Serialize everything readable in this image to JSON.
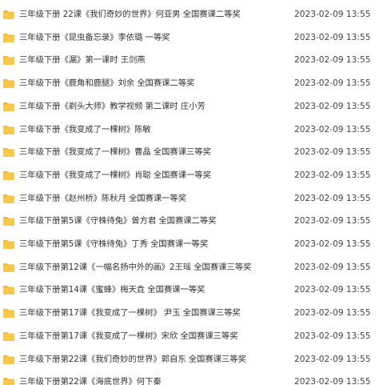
{
  "colors": {
    "folder": "#f7c84b",
    "folder_tab": "#f0b93a",
    "text": "#333333",
    "date_text": "#444444"
  },
  "icon": "folder-icon",
  "files": [
    {
      "name": "三年级下册 22课《我们奇妙的世界》何亚男 全国赛课二等奖",
      "date": "2023-02-09 13:55"
    },
    {
      "name": "三年级下册《昆虫备忘录》李依璐 一等奖",
      "date": "2023-02-09 13:55"
    },
    {
      "name": "三年级下册《漏》第一课时 王剑燕",
      "date": "2023-02-09 13:55"
    },
    {
      "name": "三年级下册《鹿角和鹿腿》刘余 全国赛课二等奖",
      "date": "2023-02-09 13:55"
    },
    {
      "name": "三年级下册《剃头大师》教学视频 第二课时 庄小芳",
      "date": "2023-02-09 13:55"
    },
    {
      "name": "三年级下册《我变成了一棵树》陈敏",
      "date": "2023-02-09 13:55"
    },
    {
      "name": "三年级下册《我变成了一棵树》曹晶 全国赛课三等奖",
      "date": "2023-02-09 13:55"
    },
    {
      "name": "三年级下册《我变成了一棵树》肖聪 全国赛课一等奖",
      "date": "2023-02-09 13:55"
    },
    {
      "name": "三年级下册《赵州桥》陈秋月 全国赛课一等奖",
      "date": "2023-02-09 13:55"
    },
    {
      "name": "三年级下册第5课《守株待兔》曾方君 全国赛课二等奖",
      "date": "2023-02-09 13:55"
    },
    {
      "name": "三年级下册第5课《守株待兔》丁秀 全国赛课一等奖",
      "date": "2023-02-09 13:55"
    },
    {
      "name": "三年级下册第12课《一幅名扬中外的画》2王瑶 全国赛课三等奖",
      "date": "2023-02-09 13:55"
    },
    {
      "name": "三年级下册第14课《蜜蜂》梅天垚 全国赛课一等奖",
      "date": "2023-02-09 13:55"
    },
    {
      "name": "三年级下册第17课《我变成了一棵树》 尹玉 全国赛课三等奖",
      "date": "2023-02-09 13:55"
    },
    {
      "name": "三年级下册第17课《我变成了一棵树》宋欣 全国赛课三等奖",
      "date": "2023-02-09 13:55"
    },
    {
      "name": "三年级下册第22课《我们奇妙的世界》郭自东 全国赛课三等奖",
      "date": "2023-02-09 13:55"
    },
    {
      "name": "三年级下册第22课《海底世界》何下秦",
      "date": "2023-02-09 13:55"
    }
  ]
}
